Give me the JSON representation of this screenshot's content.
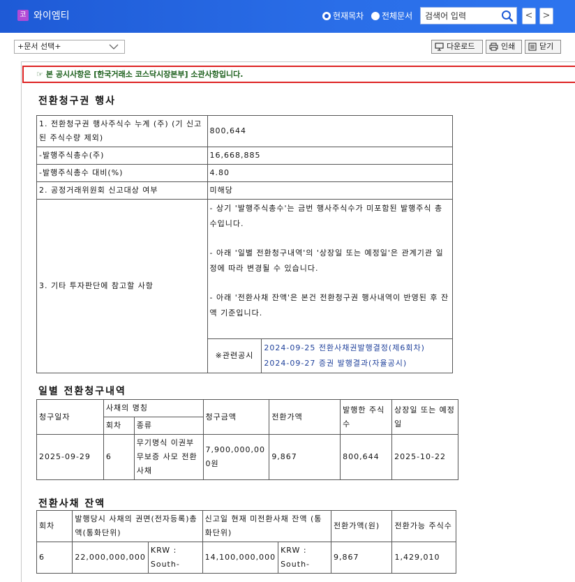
{
  "header": {
    "app_icon_glyph": "코",
    "app_title": "와이엠티",
    "radio_current": "현재목차",
    "radio_all": "전체문서",
    "search_placeholder": "검색어 입력",
    "prev_glyph": "<",
    "next_glyph": ">"
  },
  "toolbar": {
    "doc_select": "+문서 선택+",
    "download": "다운로드",
    "print": "인쇄",
    "close": "닫기"
  },
  "notice": {
    "hand_glyph": "☞",
    "text": "본 공시사항은 [한국거래소 코스닥시장본부] 소관사항입니다."
  },
  "section1": {
    "title": "전환청구권 행사",
    "rows": [
      {
        "label": "1. 전환청구권 행사주식수 누계 (주) (기 신고된 주식수량 제외)",
        "value": "800,644"
      },
      {
        "label": "-발행주식총수(주)",
        "value": "16,668,885"
      },
      {
        "label": "-발행주식총수 대비(%)",
        "value": "4.80"
      },
      {
        "label": "2. 공정거래위원회 신고대상 여부",
        "value": "미해당"
      }
    ],
    "etc_label": "3. 기타 투자판단에 참고할 사항",
    "etc_notes": [
      "- 상기 '발행주식총수'는 금번 행사주식수가 미포함된 발행주식 총수입니다.",
      "- 아래 '일별 전환청구내역'의 '상장일 또는 예정일'은 관계기관 일정에 따라 변경될 수 있습니다.",
      "- 아래 '전환사채 잔액'은 본건 전환청구권 행사내역이 반영된 후 잔액 기준입니다."
    ],
    "related_label": "※관련공시",
    "related_links": [
      "2024-09-25 전환사채권발행결정(제6회차)",
      "2024-09-27 증권 발행결과(자율공시)"
    ]
  },
  "section2": {
    "title": "일별 전환청구내역",
    "headers": {
      "date": "청구일자",
      "bond_name": "사채의 명칭",
      "round": "회차",
      "kind": "종류",
      "amount": "청구금액",
      "price": "전환가액",
      "shares": "발행한 주식수",
      "listing": "상장일 또는 예정일"
    },
    "rows": [
      {
        "date": "2025-09-29",
        "round": "6",
        "kind": "무기명식 이권부 무보증 사모 전환사채",
        "amount": "7,900,000,000원",
        "price": "9,867",
        "shares": "800,644",
        "listing": "2025-10-22"
      }
    ]
  },
  "section3": {
    "title": "전환사채 잔액",
    "headers": {
      "round": "회차",
      "face": "발행당시 사채의 권면(전자등록)총액(통화단위)",
      "remaining": "신고일 현재 미전환사채 잔액 (통화단위)",
      "price": "전환가액(원)",
      "convertible": "전환가능 주식수"
    },
    "rows": [
      {
        "round": "6",
        "face_amount": "22,000,000,000",
        "face_currency": "KRW : South-",
        "remaining_amount": "14,100,000,000",
        "remaining_currency": "KRW : South-",
        "price": "9,867",
        "convertible": "1,429,010"
      }
    ]
  },
  "colors": {
    "header_blue": "#2a6ee8",
    "notice_border": "#dd2222",
    "notice_text": "#1a5e1a",
    "link": "#1d3f9a"
  }
}
